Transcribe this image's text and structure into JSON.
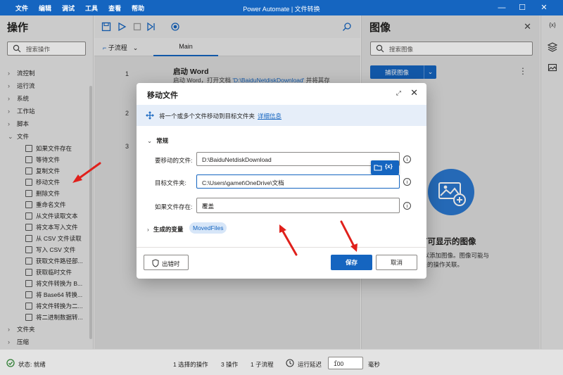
{
  "titlebar": {
    "menu": [
      "文件",
      "编辑",
      "调试",
      "工具",
      "查看",
      "帮助"
    ],
    "title": "Power Automate | 文件转换",
    "controls": {
      "minimize": "—",
      "maximize": "☐",
      "close": "✕"
    }
  },
  "actions_pane": {
    "title": "操作",
    "search_placeholder": "搜索操作",
    "groups": [
      "流控制",
      "运行流",
      "系统",
      "工作站",
      "脚本"
    ],
    "file_group": "文件",
    "file_items": [
      "如果文件存在",
      "等待文件",
      "复制文件",
      "移动文件",
      "删除文件",
      "重命名文件",
      "从文件读取文本",
      "将文本写入文件",
      "从 CSV 文件读取",
      "写入 CSV 文件",
      "获取文件路径部...",
      "获取临时文件",
      "将文件转换为 B...",
      "将 Base64 转换...",
      "将文件转换为二...",
      "将二进制数据转..."
    ],
    "after_groups": [
      "文件夹",
      "压缩"
    ]
  },
  "designer": {
    "subflow_label": "子流程",
    "main_tab": "Main",
    "steps": [
      {
        "num": "1",
        "title": "启动 Word",
        "desc_prefix": "启动 Word，打开文档 ",
        "desc_link": "'D:\\BaiduNetdiskDownload'",
        "desc_suffix": " 并将其存"
      },
      {
        "num": "2"
      },
      {
        "num": "3"
      }
    ]
  },
  "images_pane": {
    "title": "图像",
    "search_placeholder": "搜索图像",
    "capture_button": "捕获图像",
    "empty_title": "有可显示的图像",
    "empty_desc_line1": "像\"以添加图像。图像可能与",
    "empty_desc_line2": "相关的操作关联。"
  },
  "right_rail": {
    "variables_icon_label": "{x}"
  },
  "statusbar": {
    "status": "状态: 就绪",
    "selected": "1 选择的操作",
    "actions_count": "3 操作",
    "subflows": "1 子流程",
    "run_delay_label": "运行延迟",
    "run_delay_value": "100",
    "unit": "毫秒"
  },
  "dialog": {
    "title": "移动文件",
    "description": "将一个或多个文件移动到目标文件夹",
    "more_info": "详细信息",
    "section": "常规",
    "fields": {
      "files_label": "要移动的文件:",
      "files_value": "D:\\BaiduNetdiskDownload",
      "dest_label": "目标文件夹:",
      "dest_value": "C:\\Users\\gamet\\OneDrive\\文档",
      "exists_label": "如果文件存在:",
      "exists_value": "覆盖"
    },
    "popup_var": "{x}",
    "generated_label": "生成的变量",
    "generated_var": "MovedFiles",
    "on_error": "出错时",
    "save": "保存",
    "cancel": "取消"
  },
  "colors": {
    "accent": "#1565c0",
    "annotation_arrow": "#e0201b"
  }
}
